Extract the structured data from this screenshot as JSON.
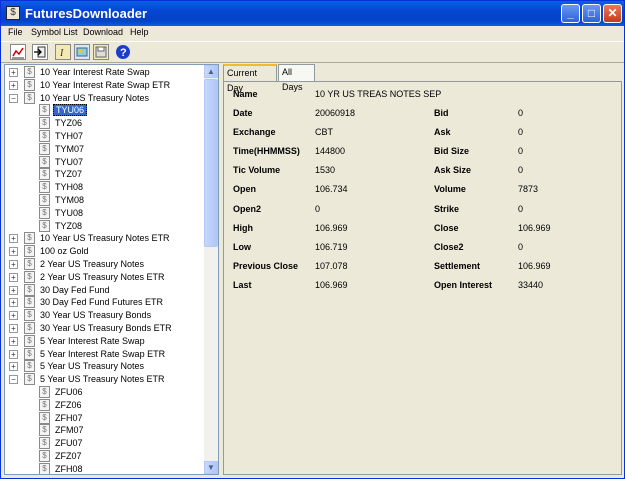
{
  "window": {
    "title": "FuturesDownloader",
    "title_icon": "$",
    "minimize": "_",
    "maximize": "□",
    "close": "✕"
  },
  "menu": [
    "File",
    "Symbol List",
    "Download",
    "Help"
  ],
  "toolbar": [
    "chart-icon",
    "export-icon",
    "text-icon",
    "image-icon",
    "disk-icon",
    "help-icon"
  ],
  "tree": [
    {
      "label": "10 Year Interest Rate Swap",
      "level": 0,
      "exp": "+"
    },
    {
      "label": "10 Year Interest Rate Swap ETR",
      "level": 0,
      "exp": "+"
    },
    {
      "label": "10 Year US Treasury Notes",
      "level": 0,
      "exp": "−"
    },
    {
      "label": "TYU06",
      "level": 1,
      "selected": true
    },
    {
      "label": "TYZ06",
      "level": 1
    },
    {
      "label": "TYH07",
      "level": 1
    },
    {
      "label": "TYM07",
      "level": 1
    },
    {
      "label": "TYU07",
      "level": 1
    },
    {
      "label": "TYZ07",
      "level": 1
    },
    {
      "label": "TYH08",
      "level": 1
    },
    {
      "label": "TYM08",
      "level": 1
    },
    {
      "label": "TYU08",
      "level": 1
    },
    {
      "label": "TYZ08",
      "level": 1
    },
    {
      "label": "10 Year US Treasury Notes ETR",
      "level": 0,
      "exp": "+"
    },
    {
      "label": "100 oz Gold",
      "level": 0,
      "exp": "+"
    },
    {
      "label": "2 Year US Treasury Notes",
      "level": 0,
      "exp": "+"
    },
    {
      "label": "2 Year US Treasury Notes ETR",
      "level": 0,
      "exp": "+"
    },
    {
      "label": "30 Day Fed Fund",
      "level": 0,
      "exp": "+"
    },
    {
      "label": "30 Day Fed Fund Futures ETR",
      "level": 0,
      "exp": "+"
    },
    {
      "label": "30 Year US Treasury Bonds",
      "level": 0,
      "exp": "+"
    },
    {
      "label": "30 Year US Treasury Bonds ETR",
      "level": 0,
      "exp": "+"
    },
    {
      "label": "5 Year Interest Rate Swap",
      "level": 0,
      "exp": "+"
    },
    {
      "label": "5 Year Interest Rate Swap ETR",
      "level": 0,
      "exp": "+"
    },
    {
      "label": "5 Year US Treasury Notes",
      "level": 0,
      "exp": "+"
    },
    {
      "label": "5 Year US Treasury Notes ETR",
      "level": 0,
      "exp": "−"
    },
    {
      "label": "ZFU06",
      "level": 1
    },
    {
      "label": "ZFZ06",
      "level": 1
    },
    {
      "label": "ZFH07",
      "level": 1
    },
    {
      "label": "ZFM07",
      "level": 1
    },
    {
      "label": "ZFU07",
      "level": 1
    },
    {
      "label": "ZFZ07",
      "level": 1
    },
    {
      "label": "ZFH08",
      "level": 1
    }
  ],
  "tabs": [
    "Current Day",
    "All Days"
  ],
  "details": {
    "name_label": "Name",
    "name_value": "10 YR US TREAS NOTES SEP",
    "left": [
      {
        "label": "Date",
        "value": "20060918"
      },
      {
        "label": "Exchange",
        "value": "CBT"
      },
      {
        "label": "Time(HHMMSS)",
        "value": "144800"
      },
      {
        "label": "Tic Volume",
        "value": "1530"
      },
      {
        "label": "Open",
        "value": "106.734"
      },
      {
        "label": "Open2",
        "value": "0"
      },
      {
        "label": "High",
        "value": "106.969"
      },
      {
        "label": "Low",
        "value": "106.719"
      },
      {
        "label": "Previous Close",
        "value": "107.078"
      },
      {
        "label": "Last",
        "value": "106.969"
      }
    ],
    "right": [
      {
        "label": "Bid",
        "value": "0"
      },
      {
        "label": "Ask",
        "value": "0"
      },
      {
        "label": "Bid Size",
        "value": "0"
      },
      {
        "label": "Ask Size",
        "value": "0"
      },
      {
        "label": "Volume",
        "value": "7873"
      },
      {
        "label": "Strike",
        "value": "0"
      },
      {
        "label": "Close",
        "value": "106.969"
      },
      {
        "label": "Close2",
        "value": "0"
      },
      {
        "label": "Settlement",
        "value": "106.969"
      },
      {
        "label": "Open Interest",
        "value": "33440"
      }
    ]
  }
}
